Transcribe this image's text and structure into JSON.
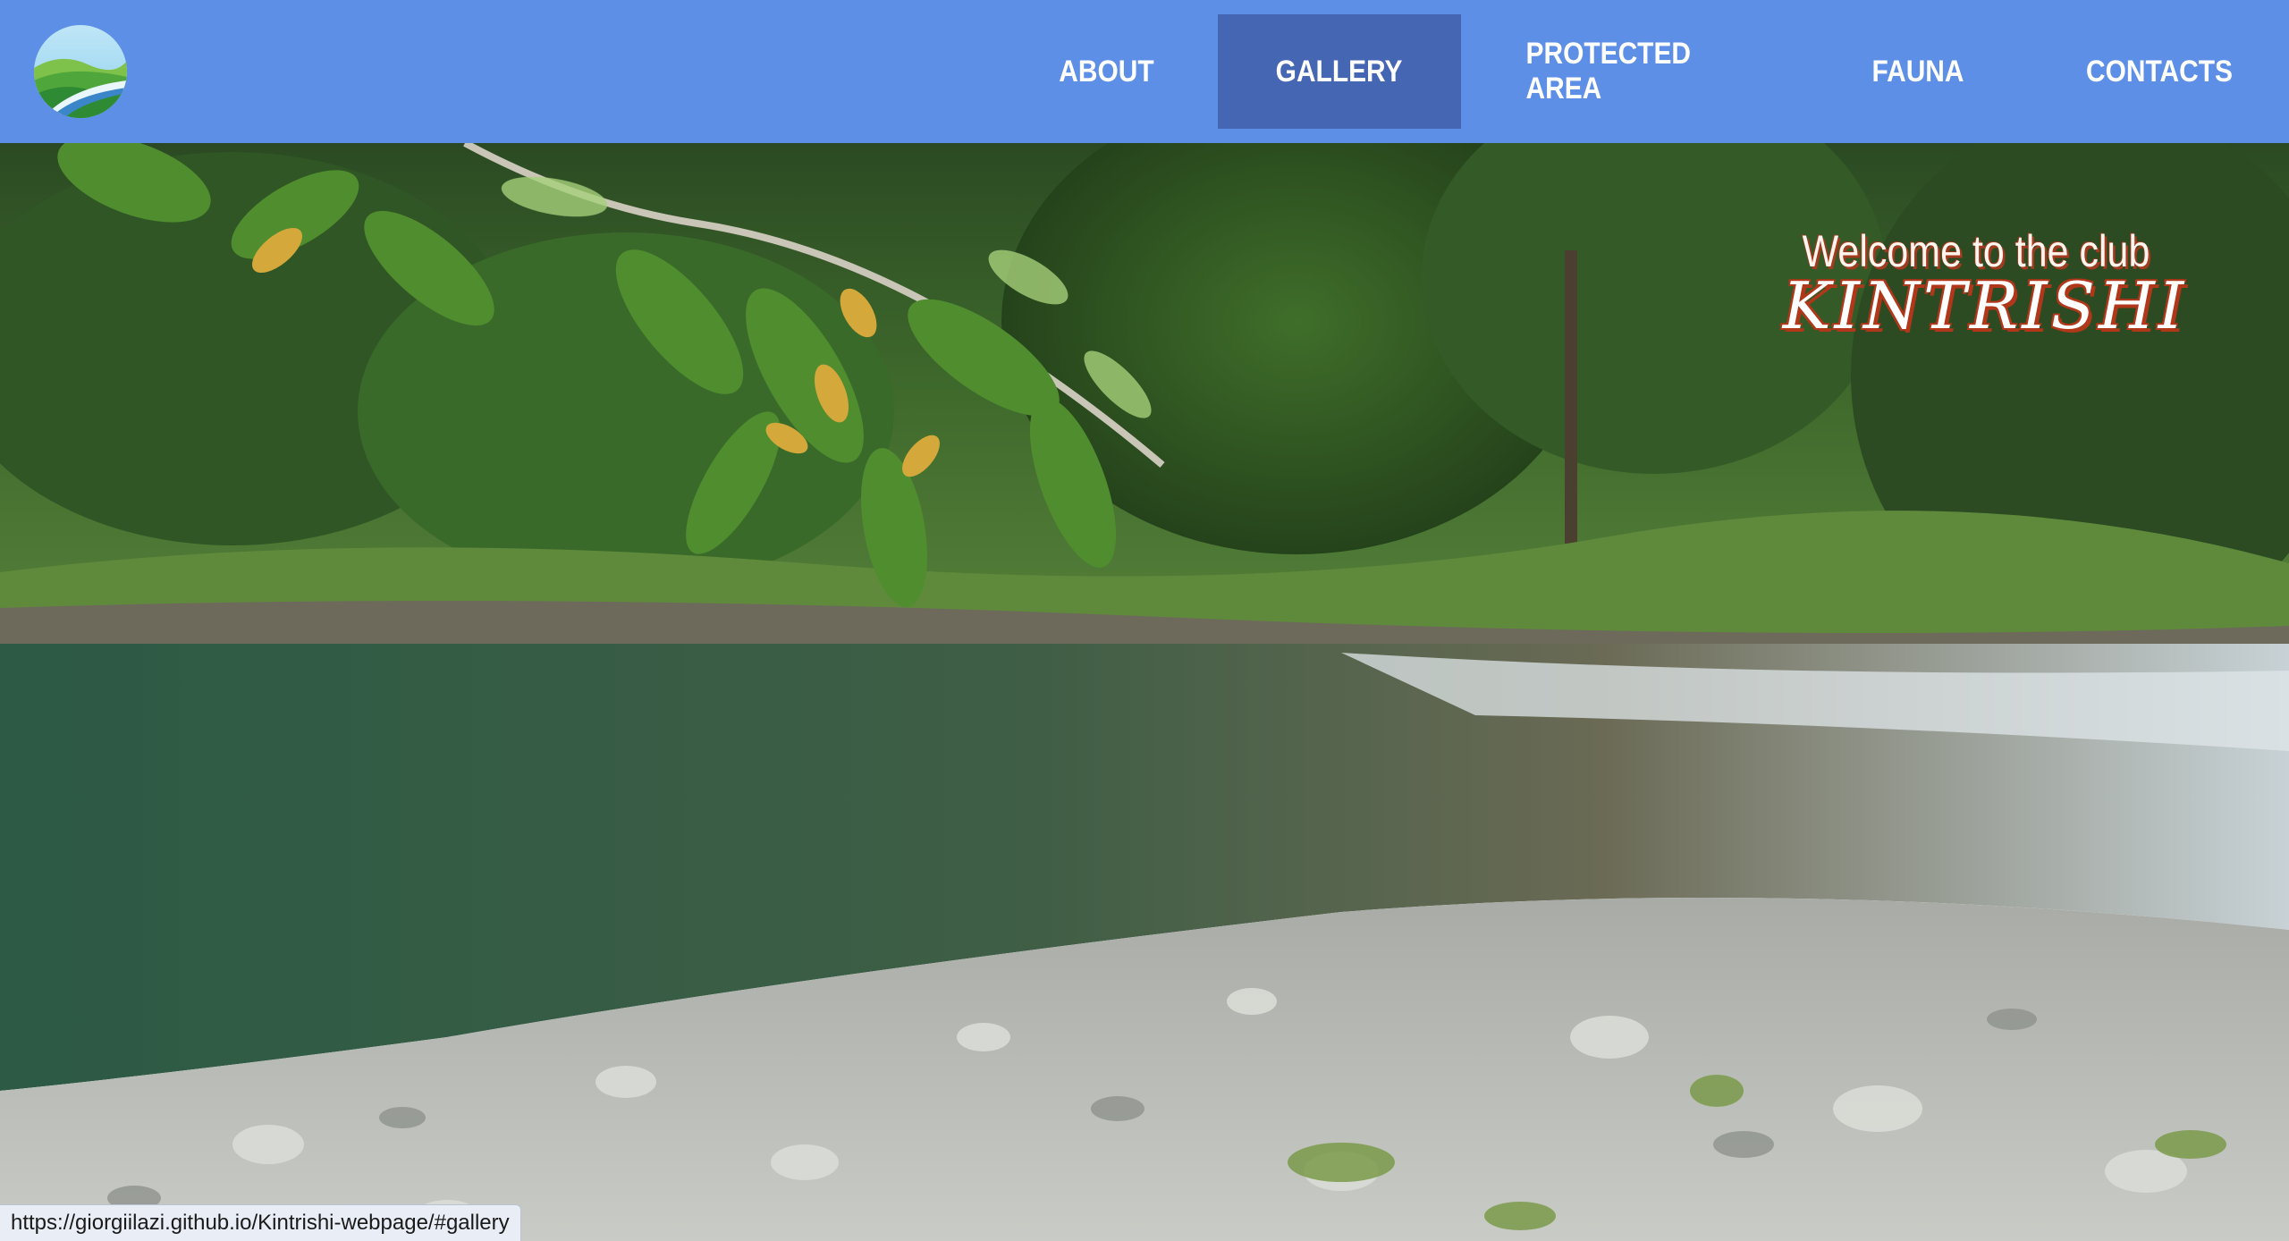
{
  "nav": {
    "logo_icon": "landscape-logo-icon",
    "items": [
      {
        "label": "ABOUT",
        "active": false
      },
      {
        "label": "GALLERY",
        "active": true
      },
      {
        "label": "PROTECTED AREA",
        "active": false
      },
      {
        "label": "FAUNA",
        "active": false
      },
      {
        "label": "CONTACTS",
        "active": false
      }
    ]
  },
  "hero": {
    "welcome_text": "Welcome to the club",
    "club_name": "KINTRISHI",
    "image": "river-with-rocky-shore-and-forest"
  },
  "status": {
    "url": "https://giorgiilazi.github.io/Kintrishi-webpage/#gallery"
  },
  "colors": {
    "navbar": "#5d8fe6",
    "nav_active": "#4566b3",
    "title_shadow": "#b0371a"
  }
}
